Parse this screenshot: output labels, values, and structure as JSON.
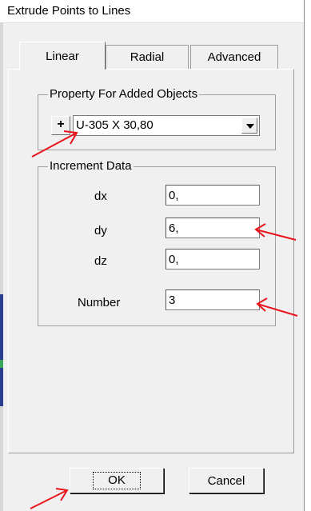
{
  "window": {
    "title": "Extrude Points to Lines"
  },
  "tabs": [
    {
      "label": "Linear",
      "active": true
    },
    {
      "label": "Radial",
      "active": false
    },
    {
      "label": "Advanced",
      "active": false
    }
  ],
  "property_group": {
    "legend": "Property For Added Objects",
    "plus_label": "+",
    "selected_section": "U-305 X 30,80"
  },
  "increment_group": {
    "legend": "Increment Data",
    "dx": {
      "label": "dx",
      "value": "0,"
    },
    "dy": {
      "label": "dy",
      "value": "6,"
    },
    "dz": {
      "label": "dz",
      "value": "0,"
    },
    "number": {
      "label": "Number",
      "value": "3"
    }
  },
  "buttons": {
    "ok": "OK",
    "cancel": "Cancel"
  },
  "colors": {
    "annotation_arrow": "#e8141c",
    "dialog_bg": "#f0f0f0"
  }
}
